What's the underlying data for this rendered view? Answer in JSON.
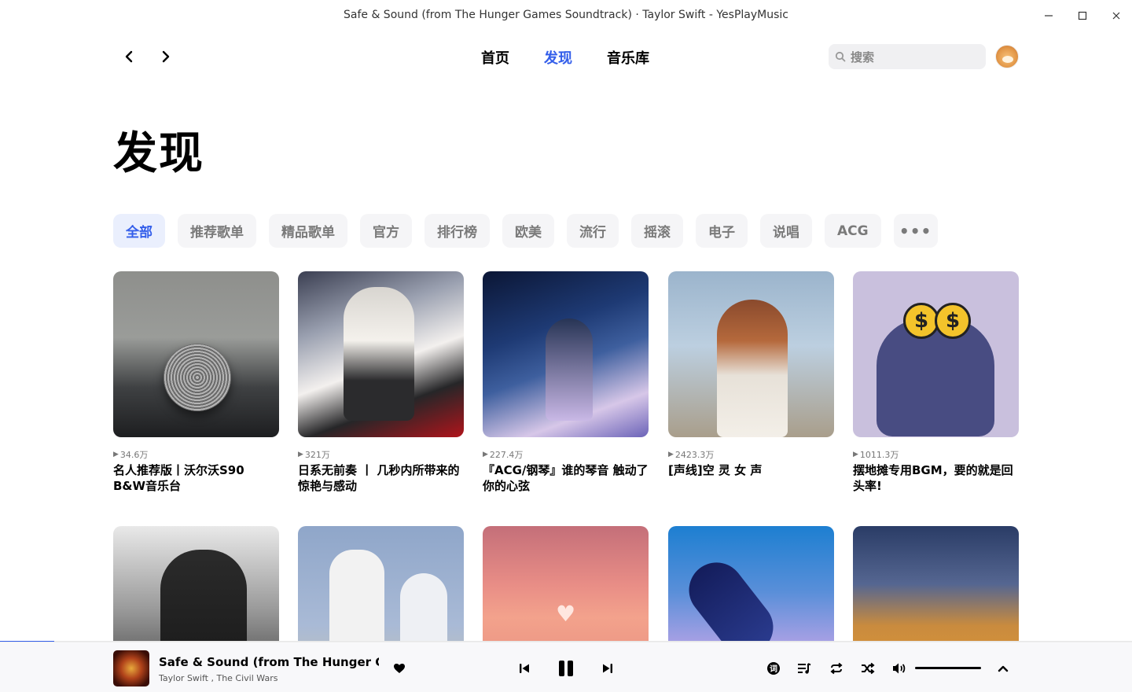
{
  "window": {
    "title": "Safe & Sound (from The Hunger Games Soundtrack) · Taylor Swift - YesPlayMusic"
  },
  "nav": {
    "links": [
      "首页",
      "发现",
      "音乐库"
    ],
    "active": "发现",
    "search_placeholder": "搜索"
  },
  "page": {
    "title": "发现"
  },
  "categories": {
    "items": [
      "全部",
      "推荐歌单",
      "精品歌单",
      "官方",
      "排行榜",
      "欧美",
      "流行",
      "摇滚",
      "电子",
      "说唱",
      "ACG"
    ],
    "active": "全部",
    "more_label": "•••"
  },
  "playlists": [
    {
      "plays": "34.6万",
      "title": "名人推荐版丨沃尔沃S90 B&W音乐台"
    },
    {
      "plays": "321万",
      "title": "日系无前奏 丨 几秒内所带来的惊艳与感动"
    },
    {
      "plays": "227.4万",
      "title": "『ACG/钢琴』谁的琴音 触动了你的心弦"
    },
    {
      "plays": "2423.3万",
      "title": "[声线]空 灵 女 声"
    },
    {
      "plays": "1011.3万",
      "title": "摆地摊专用BGM，要的就是回头率!"
    }
  ],
  "player": {
    "title": "Safe & Sound (from The Hunger Gam...",
    "artists": "Taylor Swift , The Civil Wars",
    "progress_fraction": 0.048
  },
  "colors": {
    "accent": "#335eea",
    "chip_bg": "#f5f5f7",
    "chip_active_bg": "#eaeffd"
  }
}
